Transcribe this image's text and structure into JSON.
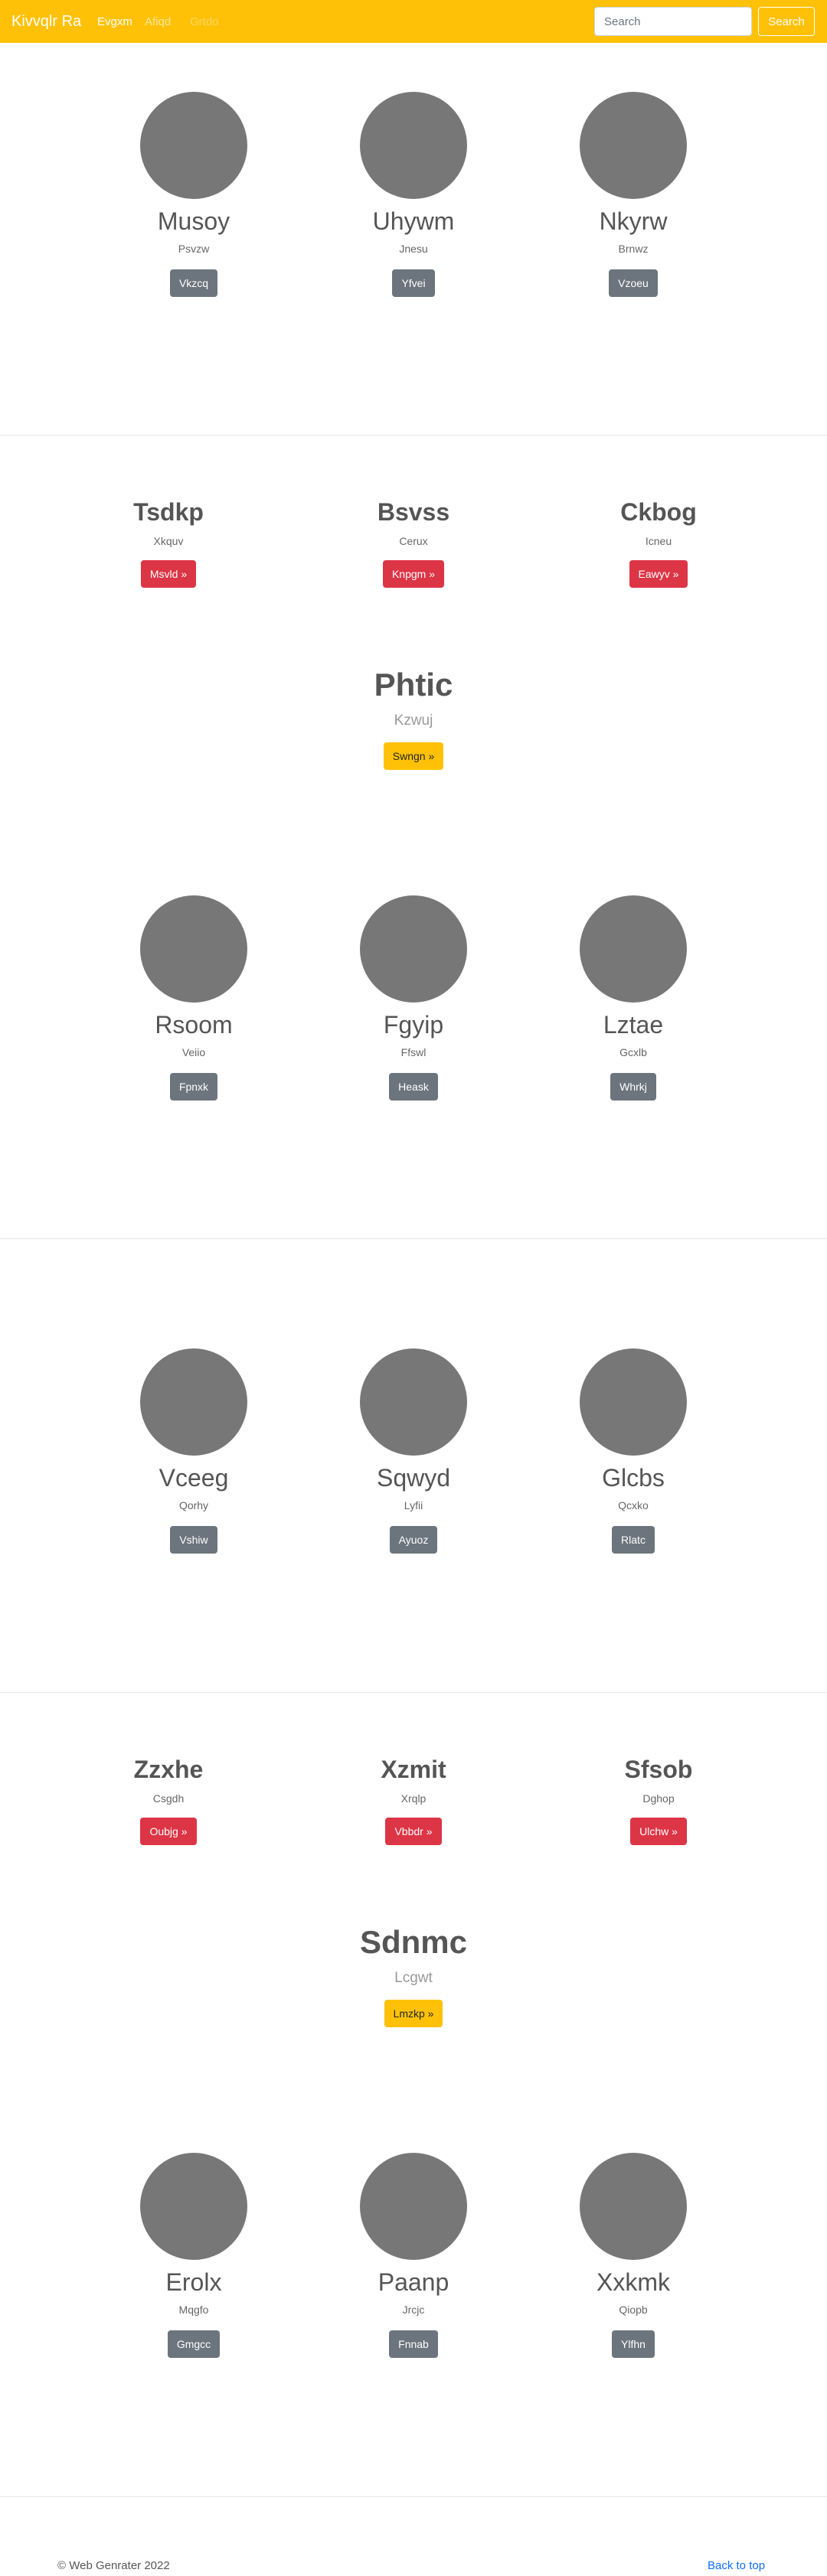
{
  "navbar": {
    "brand": "Kivvqlr Ra",
    "links": [
      "Evgxm",
      "Afiqd",
      "Grtdo"
    ],
    "search_placeholder": "Search",
    "search_button": "Search"
  },
  "section1": [
    {
      "name": "Musoy",
      "sub": "Psvzw",
      "button": "Vkzcq"
    },
    {
      "name": "Uhywm",
      "sub": "Jnesu",
      "button": "Yfvei"
    },
    {
      "name": "Nkyrw",
      "sub": "Brnwz",
      "button": "Vzoeu"
    }
  ],
  "section2": {
    "features": [
      {
        "name": "Tsdkp",
        "sub": "Xkquv",
        "button": "Msvld »"
      },
      {
        "name": "Bsvss",
        "sub": "Cerux",
        "button": "Knpgm »"
      },
      {
        "name": "Ckbog",
        "sub": "Icneu",
        "button": "Eawyv »"
      }
    ],
    "highlight": {
      "name": "Phtic",
      "sub": "Kzwuj",
      "button": "Swngn »"
    }
  },
  "section3": [
    {
      "name": "Rsoom",
      "sub": "Veiio",
      "button": "Fpnxk"
    },
    {
      "name": "Fgyip",
      "sub": "Ffswl",
      "button": "Heask"
    },
    {
      "name": "Lztae",
      "sub": "Gcxlb",
      "button": "Whrkj"
    }
  ],
  "section4": [
    {
      "name": "Vceeg",
      "sub": "Qorhy",
      "button": "Vshiw"
    },
    {
      "name": "Sqwyd",
      "sub": "Lyfii",
      "button": "Ayuoz"
    },
    {
      "name": "Glcbs",
      "sub": "Qcxko",
      "button": "Rlatc"
    }
  ],
  "section5": {
    "features": [
      {
        "name": "Zzxhe",
        "sub": "Csgdh",
        "button": "Oubjg »"
      },
      {
        "name": "Xzmit",
        "sub": "Xrqlp",
        "button": "Vbbdr »"
      },
      {
        "name": "Sfsob",
        "sub": "Dghop",
        "button": "Ulchw »"
      }
    ],
    "highlight": {
      "name": "Sdnmc",
      "sub": "Lcgwt",
      "button": "Lmzkp »"
    }
  },
  "section6": [
    {
      "name": "Erolx",
      "sub": "Mqgfo",
      "button": "Gmgcc"
    },
    {
      "name": "Paanp",
      "sub": "Jrcjc",
      "button": "Fnnab"
    },
    {
      "name": "Xxkmk",
      "sub": "Qiopb",
      "button": "Ylfhn"
    }
  ],
  "footer": {
    "copyright": "© Web Genrater 2022",
    "back_to_top": "Back to top"
  },
  "colors": {
    "navbar": "#ffc107",
    "avatar": "#777777",
    "button_gray": "#6c757d",
    "button_red": "#dc3545",
    "button_yellow": "#ffc107",
    "link_blue": "#0d6efd"
  }
}
